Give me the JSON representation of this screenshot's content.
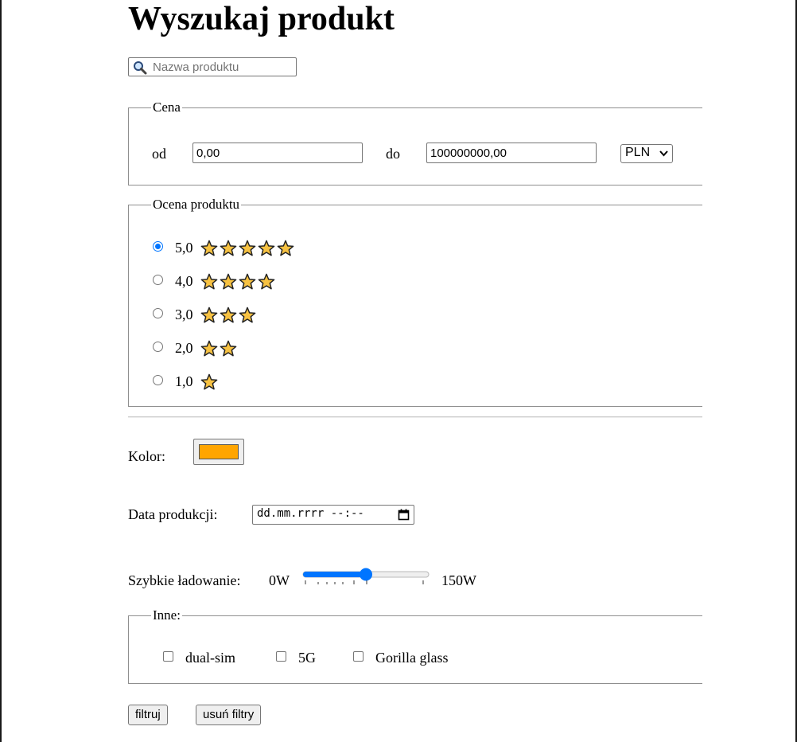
{
  "page": {
    "title": "Wyszukaj produkt"
  },
  "search": {
    "placeholder": "Nazwa produktu",
    "value": ""
  },
  "price": {
    "legend": "Cena",
    "from_label": "od",
    "from_value": "0,00",
    "to_label": "do",
    "to_value": "100000000,00",
    "currency": "PLN"
  },
  "rating": {
    "legend": "Ocena produktu",
    "options": [
      {
        "label": "5,0",
        "stars": 5,
        "checked": true
      },
      {
        "label": "4,0",
        "stars": 4,
        "checked": false
      },
      {
        "label": "3,0",
        "stars": 3,
        "checked": false
      },
      {
        "label": "2,0",
        "stars": 2,
        "checked": false
      },
      {
        "label": "1,0",
        "stars": 1,
        "checked": false
      }
    ]
  },
  "color": {
    "label": "Kolor:",
    "value": "#ffa500"
  },
  "production_date": {
    "label": "Data produkcji:",
    "placeholder": "dd.mm.rrrr --:--"
  },
  "charging": {
    "label": "Szybkie ładowanie:",
    "min_label": "0W",
    "max_label": "150W",
    "value_fraction": 0.5
  },
  "other": {
    "legend": "Inne:",
    "options": [
      {
        "label": "dual-sim",
        "checked": false
      },
      {
        "label": "5G",
        "checked": false
      },
      {
        "label": "Gorilla glass",
        "checked": false
      }
    ]
  },
  "buttons": {
    "filter": "filtruj",
    "clear": "usuń filtry"
  },
  "colors": {
    "accent": "#0075ff",
    "star": "#f7c242"
  }
}
